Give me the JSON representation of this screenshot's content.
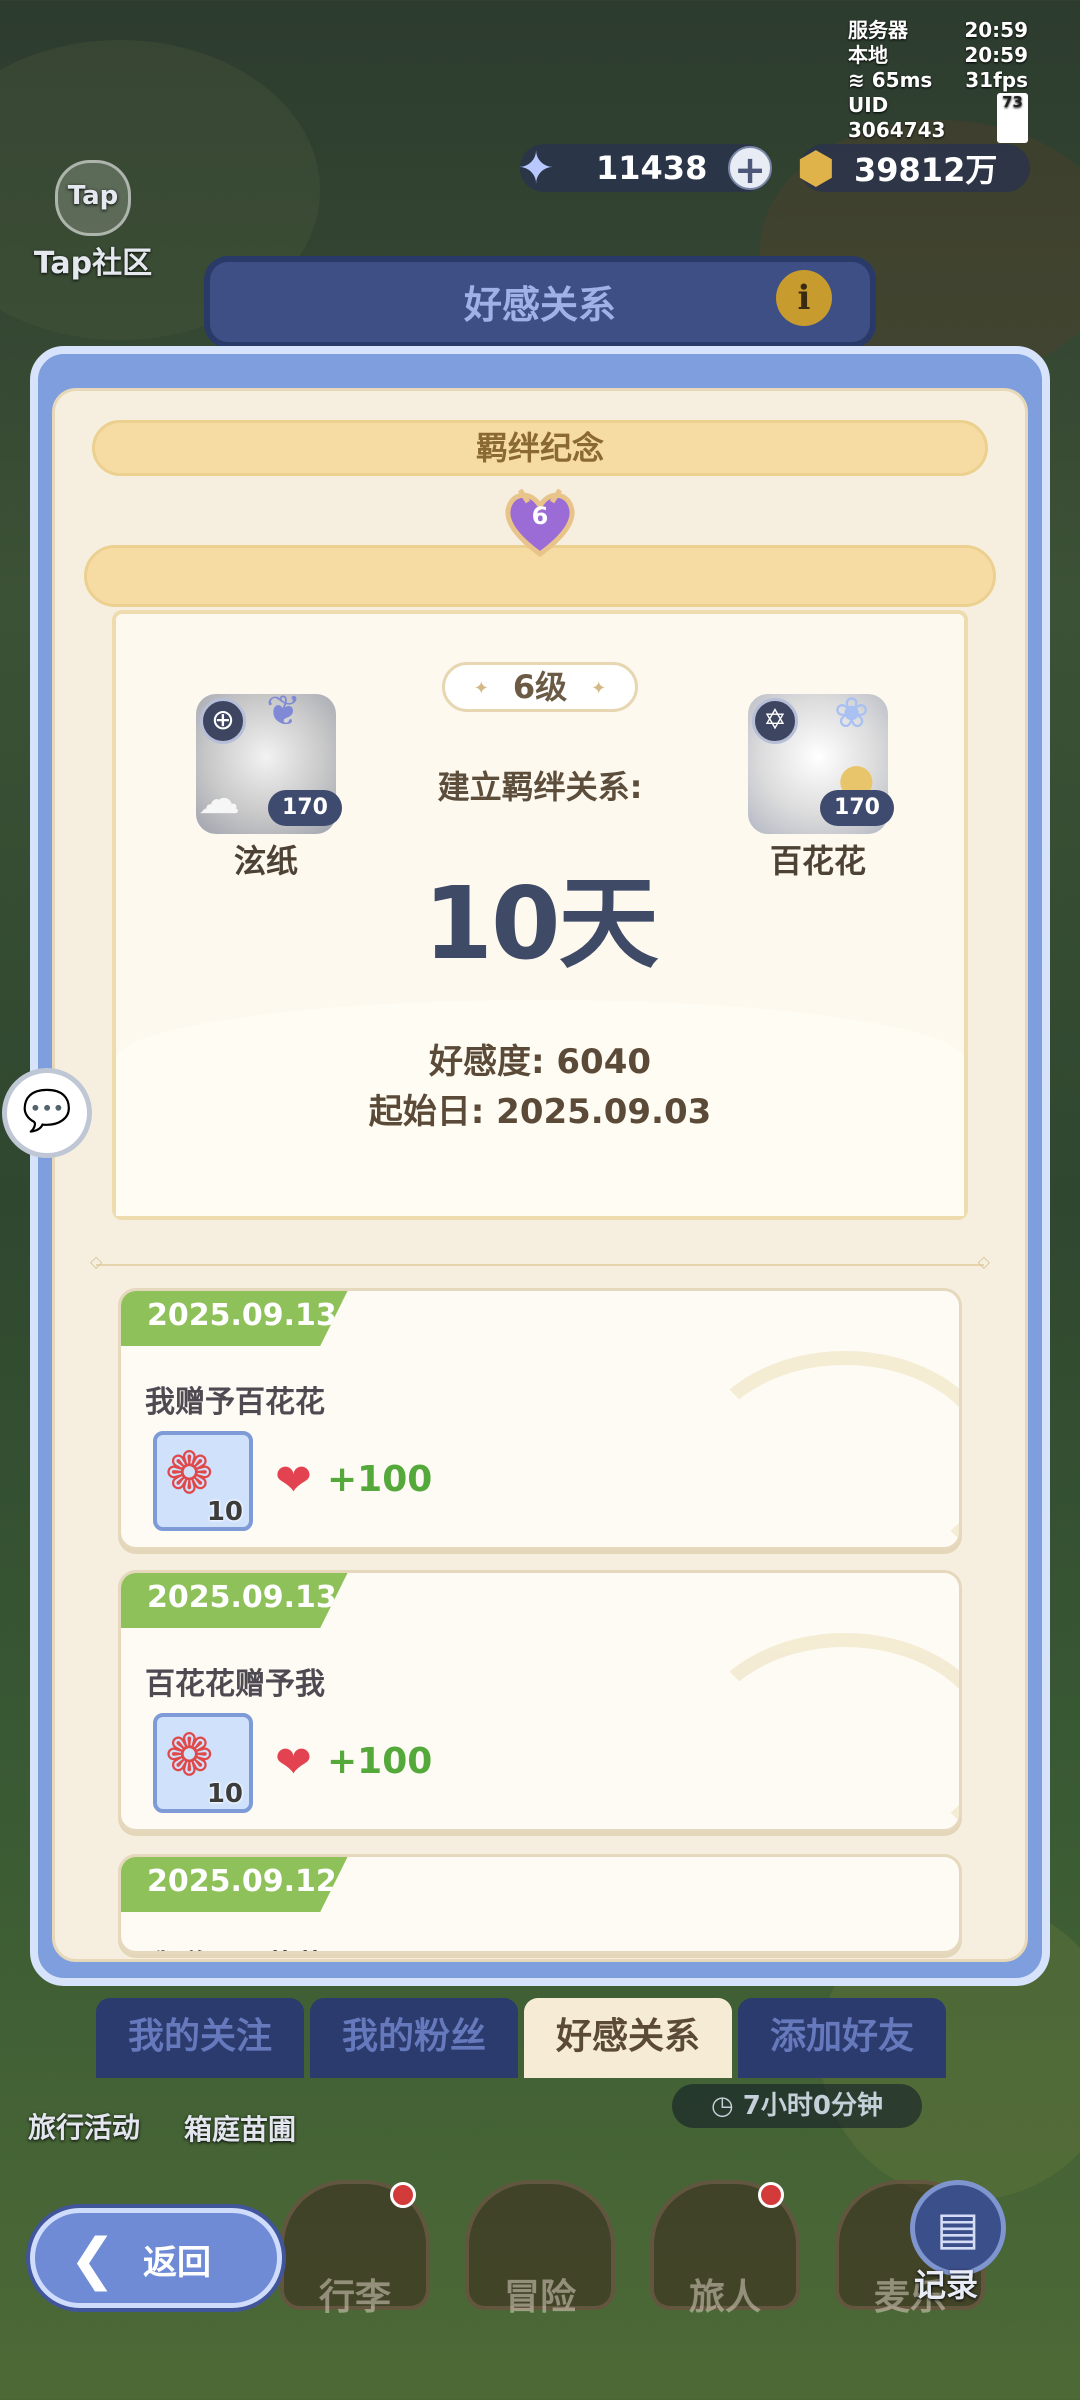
{
  "status": {
    "server_label": "服务器",
    "server_time": "20:59",
    "local_label": "本地",
    "local_time": "20:59",
    "ping": "65ms",
    "fps": "31fps",
    "uid": "UID 3064743",
    "battery": "73"
  },
  "currency": {
    "stars": "11438",
    "gold": "39812万"
  },
  "tap": {
    "logo_text": "Tap",
    "label": "Tap社区"
  },
  "panel": {
    "title": "好感关系",
    "section": "羁绊纪念",
    "heart_level": "6",
    "level_text": "6级",
    "left_player": {
      "name": "泫纸",
      "level": "170"
    },
    "right_player": {
      "name": "百花花",
      "level": "170"
    },
    "bond_label": "建立羁绊关系:",
    "bond_days": "10天",
    "affinity": "好感度: 6040",
    "start_date": "起始日: 2025.09.03"
  },
  "records": [
    {
      "date": "2025.09.13",
      "text": "我赠予百花花",
      "count": "10",
      "gain": "+100"
    },
    {
      "date": "2025.09.13",
      "text": "百花花赠予我",
      "count": "10",
      "gain": "+100"
    },
    {
      "date": "2025.09.12",
      "text": "我赠予百花花"
    }
  ],
  "friend_tabs": [
    "我的关注",
    "我的粉丝",
    "好感关系",
    "添加好友"
  ],
  "timer": "7小时0分钟",
  "side": {
    "travel": "旅行活动",
    "yard": "箱庭苗圃"
  },
  "bottom_nav": [
    "行李",
    "冒险",
    "旅人",
    "麦乐"
  ],
  "record_label": "记录",
  "back_label": "返回",
  "colors": {
    "accent_blue": "#7e9ede",
    "green_date": "#8fc15a",
    "gain_green": "#55a83a"
  }
}
